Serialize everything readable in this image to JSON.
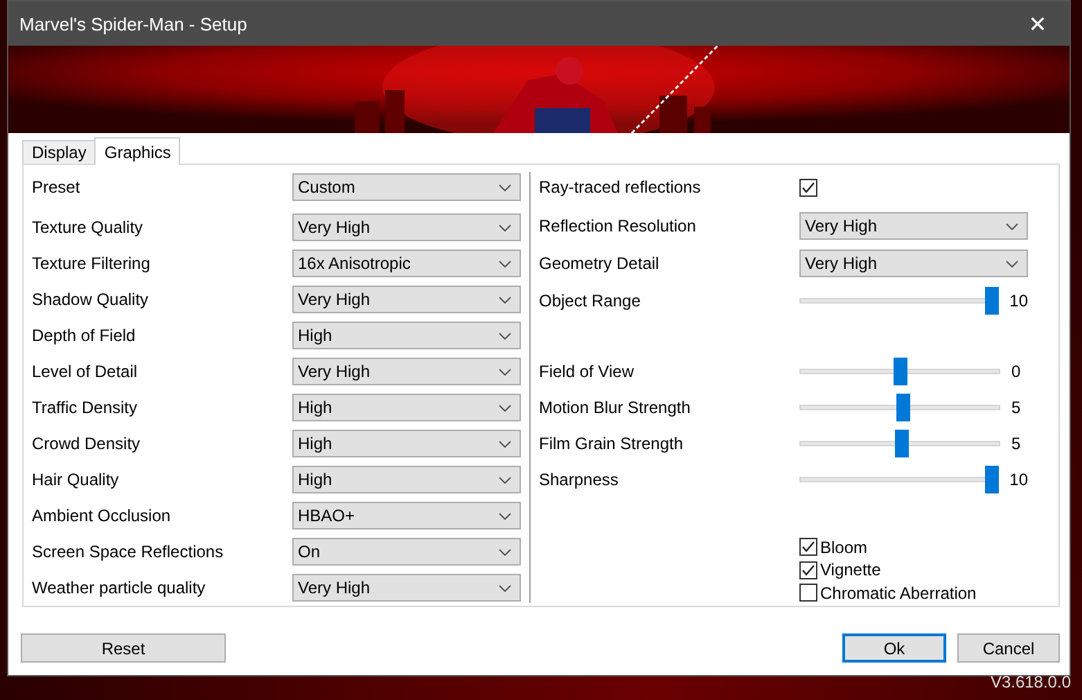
{
  "window": {
    "title": "Marvel's Spider-Man - Setup",
    "close": "✕"
  },
  "tabs": [
    {
      "label": "Display",
      "selected": false
    },
    {
      "label": "Graphics",
      "selected": true
    }
  ],
  "left_settings": [
    {
      "label": "Preset",
      "value": "Custom"
    },
    {
      "label": "Texture Quality",
      "value": "Very High"
    },
    {
      "label": "Texture Filtering",
      "value": "16x Anisotropic"
    },
    {
      "label": "Shadow Quality",
      "value": "Very High"
    },
    {
      "label": "Depth of Field",
      "value": "High"
    },
    {
      "label": "Level of Detail",
      "value": "Very High"
    },
    {
      "label": "Traffic Density",
      "value": "High"
    },
    {
      "label": "Crowd Density",
      "value": "High"
    },
    {
      "label": "Hair Quality",
      "value": "High"
    },
    {
      "label": "Ambient Occlusion",
      "value": "HBAO+"
    },
    {
      "label": "Screen Space Reflections",
      "value": "On"
    },
    {
      "label": "Weather particle quality",
      "value": "Very High"
    }
  ],
  "right_settings": [
    {
      "kind": "checkbox",
      "label": "Ray-traced reflections",
      "checked": true
    },
    {
      "kind": "select",
      "label": "Reflection Resolution",
      "value": "Very High"
    },
    {
      "kind": "select",
      "label": "Geometry Detail",
      "value": "Very High"
    },
    {
      "kind": "slider",
      "label": "Object Range",
      "level": 1,
      "reading": "10"
    }
  ],
  "camera_sliders": [
    {
      "label": "Field of View",
      "level": 0.5,
      "reading": "0"
    },
    {
      "label": "Motion Blur Strength",
      "level": 0.52,
      "reading": "5"
    },
    {
      "label": "Film Grain Strength",
      "level": 0.51,
      "reading": "5"
    },
    {
      "label": "Sharpness",
      "level": 1,
      "reading": "10"
    }
  ],
  "effects": [
    {
      "label": "Bloom",
      "checked": true
    },
    {
      "label": "Vignette",
      "checked": true
    },
    {
      "label": "Chromatic Aberration",
      "checked": false
    }
  ],
  "buttons": {
    "reset": "Reset",
    "ok": "Ok",
    "cancel": "Cancel"
  },
  "version": "V3.618.0.0"
}
